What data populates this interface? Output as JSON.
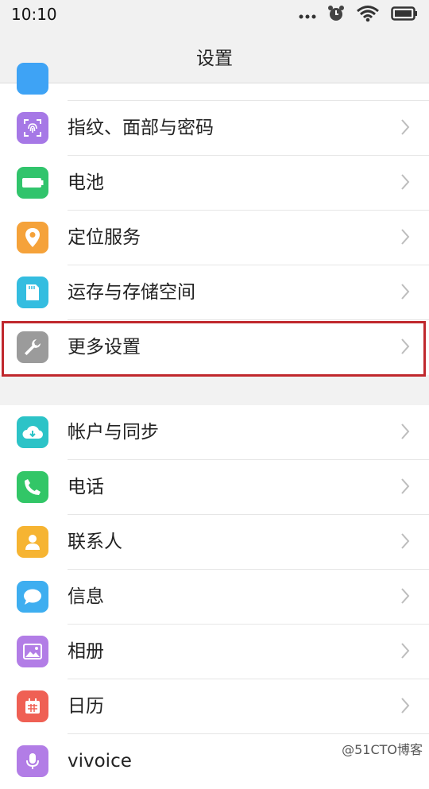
{
  "status_bar": {
    "time": "10:10",
    "icons": [
      "more-dots-icon",
      "alarm-icon",
      "wifi-icon",
      "battery-icon"
    ]
  },
  "header": {
    "title": "设置"
  },
  "group1": {
    "items": [
      {
        "label": "",
        "icon": "partial-blue-icon",
        "color": "#3ea3f5"
      },
      {
        "label": "指纹、面部与密码",
        "icon": "fingerprint-icon",
        "color": "#a678e6"
      },
      {
        "label": "电池",
        "icon": "battery-icon",
        "color": "#31c46c"
      },
      {
        "label": "定位服务",
        "icon": "location-pin-icon",
        "color": "#f5a23a"
      },
      {
        "label": "运存与存储空间",
        "icon": "sd-card-icon",
        "color": "#34bde0"
      },
      {
        "label": "更多设置",
        "icon": "wrench-icon",
        "color": "#9b9b9b"
      }
    ]
  },
  "group2": {
    "items": [
      {
        "label": "帐户与同步",
        "icon": "cloud-icon",
        "color": "#2cc3c7"
      },
      {
        "label": "电话",
        "icon": "phone-icon",
        "color": "#32c667"
      },
      {
        "label": "联系人",
        "icon": "person-icon",
        "color": "#f6b432"
      },
      {
        "label": "信息",
        "icon": "message-bubble-icon",
        "color": "#3eaef0"
      },
      {
        "label": "相册",
        "icon": "photo-icon",
        "color": "#b27de6"
      },
      {
        "label": "日历",
        "icon": "calendar-icon",
        "color": "#ef6054"
      },
      {
        "label": "vivoice",
        "icon": "microphone-icon",
        "color": "#b27de6"
      }
    ]
  },
  "watermark": "@51CTO博客"
}
